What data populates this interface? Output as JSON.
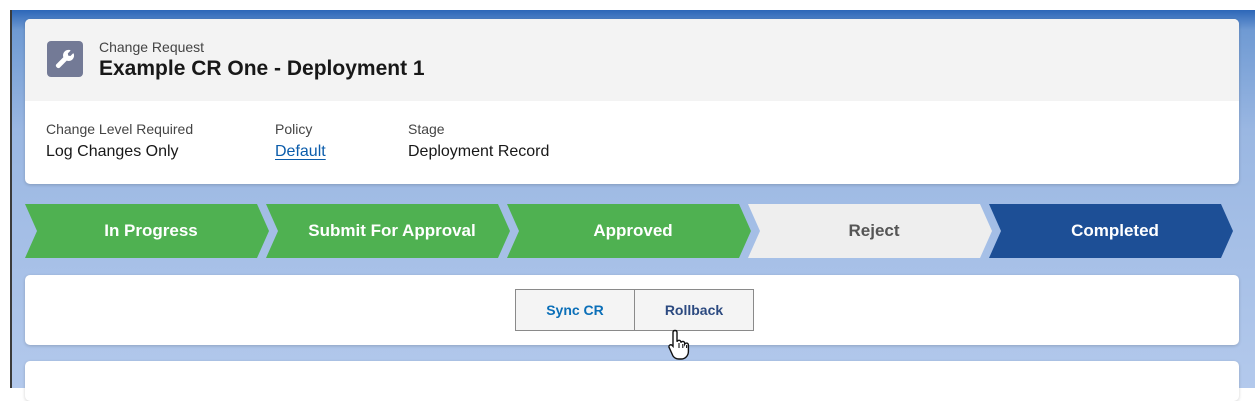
{
  "record": {
    "object_label": "Change Request",
    "title": "Example CR One - Deployment 1",
    "icon": "wrench-icon"
  },
  "fields": [
    {
      "label": "Change Level Required",
      "value": "Log Changes Only"
    },
    {
      "label": "Policy",
      "value": "Default"
    },
    {
      "label": "Stage",
      "value": "Deployment Record"
    }
  ],
  "path": {
    "steps": [
      {
        "label": "In Progress",
        "state": "complete"
      },
      {
        "label": "Submit For Approval",
        "state": "complete"
      },
      {
        "label": "Approved",
        "state": "complete"
      },
      {
        "label": "Reject",
        "state": "incomplete"
      },
      {
        "label": "Completed",
        "state": "current"
      }
    ],
    "colors": {
      "complete": "#4fb151",
      "incomplete": "#eeeeee",
      "current": "#1d4f96"
    }
  },
  "actions": {
    "sync_label": "Sync CR",
    "rollback_label": "Rollback"
  },
  "cursor": "hand-pointer-icon",
  "colors": {
    "brand_blue": "#2d67b8",
    "link": "#0b5cab",
    "icon_bg": "#737a96"
  }
}
